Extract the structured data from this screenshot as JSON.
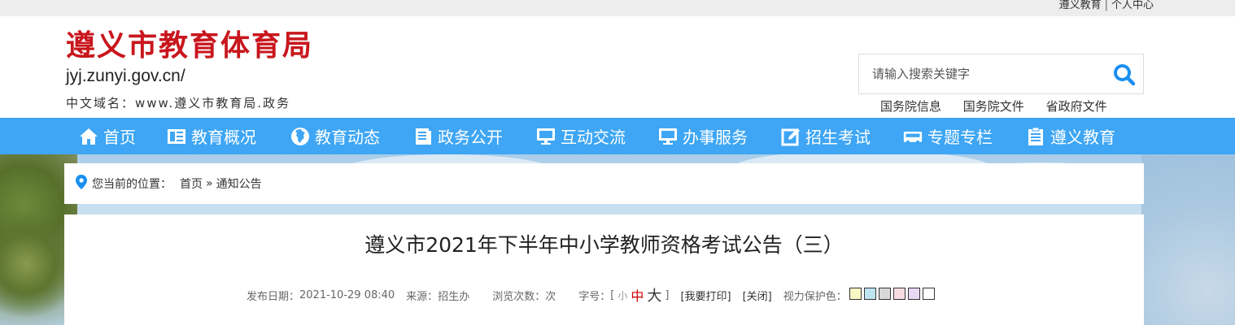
{
  "topbar": {
    "links": [
      "遵义教育",
      "个人中心"
    ],
    "separator": "|"
  },
  "header": {
    "title": "遵义市教育体育局",
    "domain": "jyj.zunyi.gov.cn/",
    "cn_domain": "中文域名：www.遵义市教育局.政务"
  },
  "search": {
    "placeholder": "请输入搜索关键字",
    "quick_links": [
      "国务院信息",
      "国务院文件",
      "省政府文件"
    ]
  },
  "nav": {
    "items": [
      {
        "label": "首页",
        "icon": "home-icon"
      },
      {
        "label": "教育概况",
        "icon": "profile-icon"
      },
      {
        "label": "教育动态",
        "icon": "globe-icon"
      },
      {
        "label": "政务公开",
        "icon": "document-icon"
      },
      {
        "label": "互动交流",
        "icon": "monitor-icon"
      },
      {
        "label": "办事服务",
        "icon": "monitor-icon"
      },
      {
        "label": "招生考试",
        "icon": "edit-icon"
      },
      {
        "label": "专题专栏",
        "icon": "bus-icon"
      },
      {
        "label": "遵义教育",
        "icon": "clipboard-icon"
      }
    ]
  },
  "breadcrumb": {
    "prefix": "您当前的位置：",
    "items": [
      "首页",
      "通知公告"
    ],
    "separator": "»"
  },
  "article": {
    "title": "遵义市2021年下半年中小学教师资格考试公告（三）",
    "meta": {
      "publish_label": "发布日期：",
      "publish_date": "2021-10-29 08:40",
      "source_label": "来源：",
      "source": "招生办",
      "views_label": "浏览次数：",
      "views_unit": "次",
      "font_label": "字号：",
      "bracket_open": "[",
      "bracket_close": "]",
      "size_small": "小",
      "size_medium": "中",
      "size_large": "大",
      "print": "[我要打印]",
      "close": "[关闭]",
      "eye_label": "视力保护色："
    },
    "eye_colors": [
      "#faf7c5",
      "#bee4f2",
      "#d8d8d8",
      "#f8dce4",
      "#e8d8f4",
      "#ffffff"
    ]
  },
  "colors": {
    "nav_bg": "#3ea6f4",
    "brand_red": "#c8161d",
    "accent_blue": "#1a8ff0"
  }
}
